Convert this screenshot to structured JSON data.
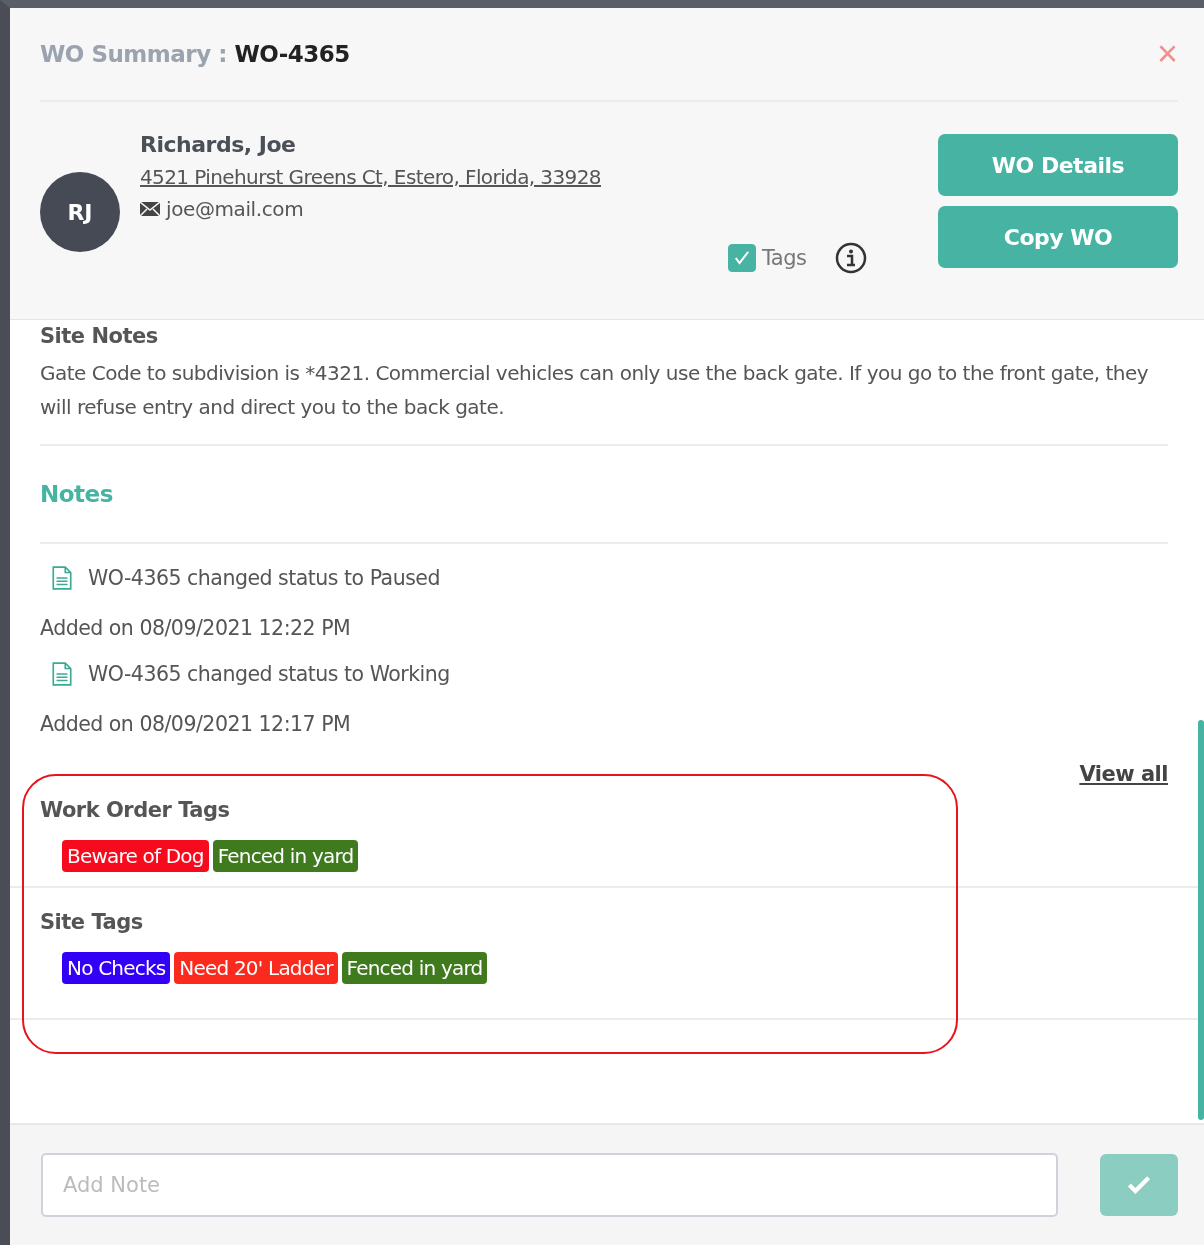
{
  "header": {
    "title_label": "WO Summary :",
    "title_value": "WO-4365",
    "close": "×"
  },
  "customer": {
    "initials": "RJ",
    "name": "Richards, Joe",
    "address": "4521 Pinehurst Greens Ct, Estero, Florida, 33928",
    "email": "joe@mail.com"
  },
  "tags_toggle": {
    "label": "Tags",
    "checked": true
  },
  "buttons": [
    "WO Details",
    "Copy WO"
  ],
  "site_notes": {
    "heading": "Site Notes",
    "text": "Gate Code to subdivision is *4321. Commercial vehicles can only use the back gate. If you go to the front gate, they will refuse entry and direct you to the back gate."
  },
  "notes": {
    "heading": "Notes",
    "items": [
      {
        "text": "WO-4365 changed status to Paused",
        "added": "Added on 08/09/2021 12:22 PM"
      },
      {
        "text": "WO-4365 changed status to Working",
        "added": "Added on 08/09/2021 12:17 PM"
      }
    ],
    "view_all": "View all"
  },
  "tag_groups": [
    {
      "heading": "Work Order Tags",
      "tags": [
        {
          "label": "Beware of Dog",
          "color": "#f50a1e"
        },
        {
          "label": "Fenced in yard",
          "color": "#3f7a1f"
        }
      ]
    },
    {
      "heading": "Site Tags",
      "tags": [
        {
          "label": "No Checks",
          "color": "#3300f5"
        },
        {
          "label": "Need 20' Ladder",
          "color": "#fa2a1e"
        },
        {
          "label": "Fenced in yard",
          "color": "#3f7a1f"
        }
      ]
    }
  ],
  "add_note": {
    "placeholder": "Add Note"
  }
}
